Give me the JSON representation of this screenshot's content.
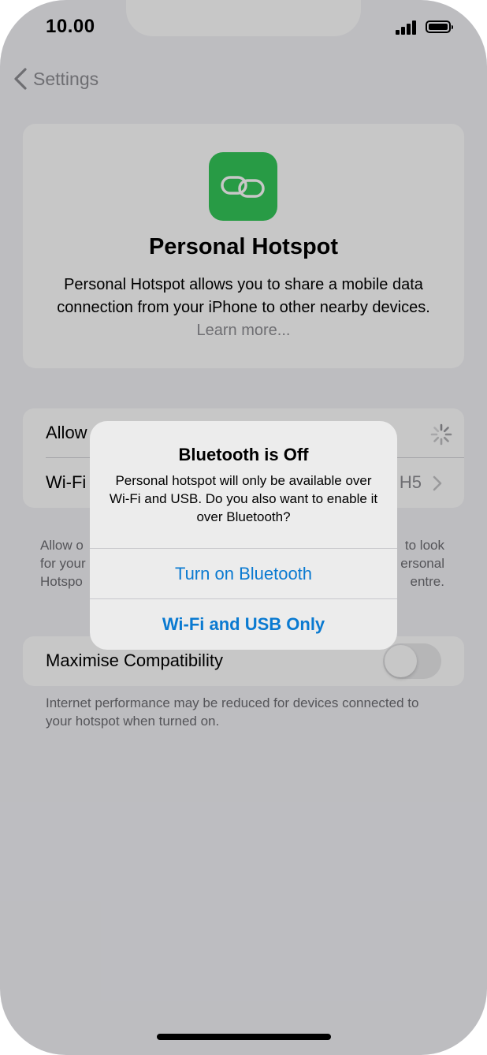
{
  "status_bar": {
    "time": "10.00"
  },
  "nav": {
    "back_label": "Settings"
  },
  "info_card": {
    "title": "Personal Hotspot",
    "description": "Personal Hotspot allows you to share a mobile data connection from your iPhone to other nearby devices.",
    "learn_more": "Learn more..."
  },
  "settings": {
    "allow_others_label": "Allow",
    "wifi_password_label": "Wi-Fi",
    "wifi_password_value": "H5",
    "footer_left": [
      "Allow o",
      "for your",
      "Hotspo"
    ],
    "footer_right": [
      "to look",
      "ersonal",
      "entre."
    ],
    "maximise_label": "Maximise Compatibility",
    "maximise_footer": "Internet performance may be reduced for devices connected to your hotspot when turned on."
  },
  "alert": {
    "title": "Bluetooth is Off",
    "message": "Personal hotspot will only be available over Wi-Fi and USB. Do you also want to enable it over Bluetooth?",
    "primary_button": "Turn on Bluetooth",
    "secondary_button": "Wi-Fi and USB Only"
  },
  "colors": {
    "accent": "#0a7ad1",
    "hotspot_icon_bg": "#34c759",
    "background": "#f2f2f7"
  },
  "icons": [
    "chevron-left-icon",
    "link-icon",
    "spinner-icon",
    "chevron-right-icon",
    "cellular-signal-icon",
    "battery-icon"
  ]
}
